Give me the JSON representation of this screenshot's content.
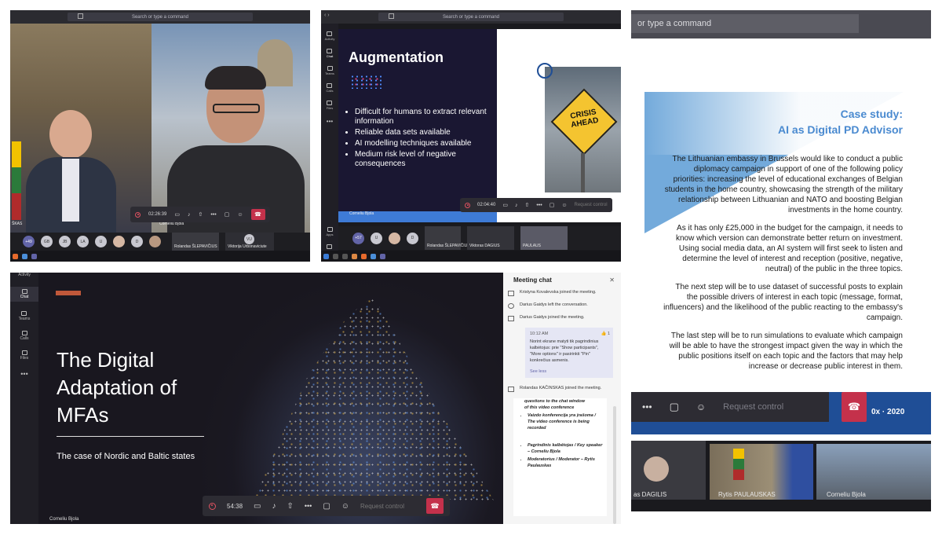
{
  "accent_colors": {
    "teams_purple": "#6264a7",
    "hangup_red": "#c4314b",
    "slide_blue": "#1f4e96",
    "deck_orange": "#c0583a"
  },
  "panel_tl": {
    "search": "Search or type a command",
    "timer": "02:26:39",
    "self_name": "Corneliu Bjola",
    "left_name": "ŠKAS",
    "participants": [
      "+49",
      "GB",
      "JB",
      "LA",
      "U",
      "D"
    ],
    "named": [
      {
        "name": "Rolandas ŠLEPAVIČIUS"
      },
      {
        "name": "Viktorija Urbonaviciute"
      }
    ],
    "named_initials": "VU"
  },
  "panel_tm": {
    "search": "Search or type a command",
    "rail": [
      "Activity",
      "Chat",
      "Teams",
      "Calls",
      "Files",
      "Apps",
      "Help"
    ],
    "slide_title": "Augmentation",
    "bullets": [
      "Difficult for humans to extract relevant information",
      "Reliable data sets available",
      "AI modelling techniques available",
      "Medium risk level of negative consequences"
    ],
    "sign_line1": "CRISIS",
    "sign_line2": "AHEAD",
    "timer": "02:04:40",
    "request_control": "Request control",
    "presenter": "Corneliu Bjola",
    "participants": [
      "+57",
      "U",
      "D"
    ],
    "named": [
      {
        "name": "Rolandas ŠLEPAVIČIUS"
      },
      {
        "name": "Viktoras DAGIUS"
      },
      {
        "name": "PAULAUS"
      }
    ]
  },
  "panel_right": {
    "search": "or type a command",
    "heading1": "Case study:",
    "heading2": "AI as Digital PD Advisor",
    "p1": "The Lithuanian embassy in Brussels would like to conduct a public diplomacy campaign in support of one of the following policy priorities: increasing the level of educational exchanges of Belgian students in the home country,  showcasing the strength of the military relationship between Lithuanian and NATO and boosting Belgian investments in the home country.",
    "p2": "As it has only £25,000 in the budget for the campaign, it needs to know which version can demonstrate better return on investment. Using social media data, an AI system will first seek to listen and determine the level of interest and reception (positive, negative, neutral) of the public in the three topics.",
    "p3": "The next step will be to use dataset of successful posts to explain the possible drivers of interest in each topic (message, format, influencers) and the likelihood of the public reacting to the embassy's campaign.",
    "p4": "The last step will be to run simulations to evaluate which campaign will be able to have the strongest impact given the way in which the public positions itself on each topic and the factors that may help increase or decrease public interest in them.",
    "request_control": "Request control",
    "year_text": "0x · 2020",
    "names": [
      "as DAGILIS",
      "Rytis PAULAUSKAS",
      "Corneliu Bjola"
    ]
  },
  "panel_bottom": {
    "rail": [
      "Activity",
      "Chat",
      "Teams",
      "Calls",
      "Files"
    ],
    "title_line1": "The Digital",
    "title_line2": "Adaptation of",
    "title_line3": "MFAs",
    "subtitle": "The case of Nordic and Baltic states",
    "presenter": "Corneliu Bjola",
    "timer": "54:38",
    "request_control": "Request control",
    "chat_title": "Meeting chat",
    "chat_events": [
      "Kristyna Kovalevska joined the meeting.",
      "Darius Gaidys left the conversation.",
      "Darius Gaidys joined the meeting."
    ],
    "msg_time": "10:12 AM",
    "msg_reaction": "👍 1",
    "msg_text": "Norint ekrane matyti tik pagrindinius kalbėtojus: prie \"Show participants\", \"More options\" ir pasirinkti \"Pin\" konkrečius asmenis.",
    "see_less": "See less",
    "chat_event_last": "Rolandas KAČINSKAS joined the meeting.",
    "note_line1": "questions to the chat window",
    "note_line2": "of this video conference",
    "note_item1": "Vaizdo konferencija yra įrašoma / The video conference is being recorded",
    "note_item2": "Pagrindinis kalbėtojas / Key speaker – Corneliu Bjola",
    "note_item3": "Moderatorius / Moderator – Rytis Paulauskas"
  }
}
